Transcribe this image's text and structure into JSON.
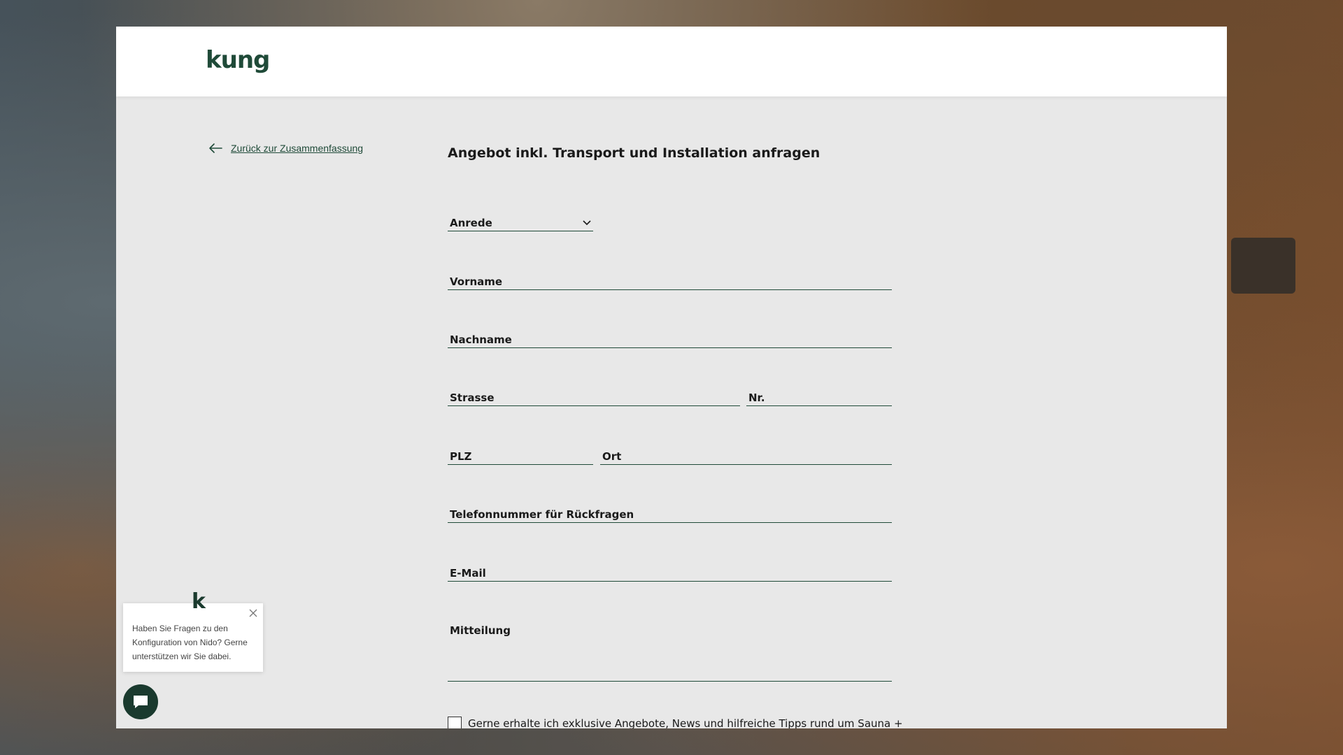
{
  "brand": {
    "logo_text": "kung",
    "accent_color": "#1f4a38"
  },
  "nav": {
    "back_label": "Zurück zur Zusammenfassung"
  },
  "form": {
    "title": "Angebot inkl. Transport und Installation anfragen",
    "salutation_label": "Anrede",
    "firstname_label": "Vorname",
    "lastname_label": "Nachname",
    "street_label": "Strasse",
    "number_label": "Nr.",
    "zip_label": "PLZ",
    "city_label": "Ort",
    "phone_label": "Telefonnummer für Rückfragen",
    "email_label": "E-Mail",
    "message_label": "Mitteilung",
    "consent_text": "Gerne erhalte ich exklusive Angebote, News und hilfreiche Tipps rund um Sauna +"
  },
  "chat": {
    "logo_letter": "k",
    "message": "Haben Sie Fragen zu den Konfiguration von Nido? Gerne unterstützen wir Sie dabei."
  }
}
